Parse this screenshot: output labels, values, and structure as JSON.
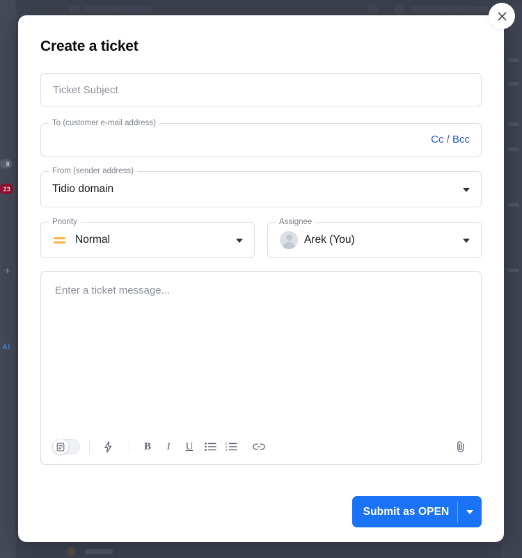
{
  "modal": {
    "title": "Create a ticket",
    "close_icon": "close-icon"
  },
  "fields": {
    "subject": {
      "placeholder": "Ticket Subject"
    },
    "to": {
      "legend": "To (customer e-mail address)",
      "value": "",
      "cc_bcc_label": "Cc / Bcc"
    },
    "from": {
      "legend": "From (sender address)",
      "value": "Tidio domain"
    },
    "priority": {
      "legend": "Priority",
      "value": "Normal",
      "icon": "priority-normal-icon",
      "icon_color": "#f5b14a"
    },
    "assignee": {
      "legend": "Assignee",
      "value": "Arek (You)",
      "avatar": "user-avatar-icon"
    }
  },
  "editor": {
    "placeholder": "Enter a ticket message...",
    "toolbar": {
      "note_toggle": "note-toggle",
      "quick_reply": "lightning-icon",
      "bold": "B",
      "italic": "I",
      "underline": "U",
      "bullet_list": "bullet-list-icon",
      "numbered_list": "numbered-list-icon",
      "link": "link-icon",
      "attachment": "paperclip-icon"
    }
  },
  "submit": {
    "label": "Submit as OPEN",
    "dropdown_icon": "chevron-down-icon",
    "color": "#1a73f5"
  },
  "background": {
    "badge_dark": "8",
    "badge_red": "23",
    "add_icon": "plus-icon",
    "ai_label": "AI"
  }
}
